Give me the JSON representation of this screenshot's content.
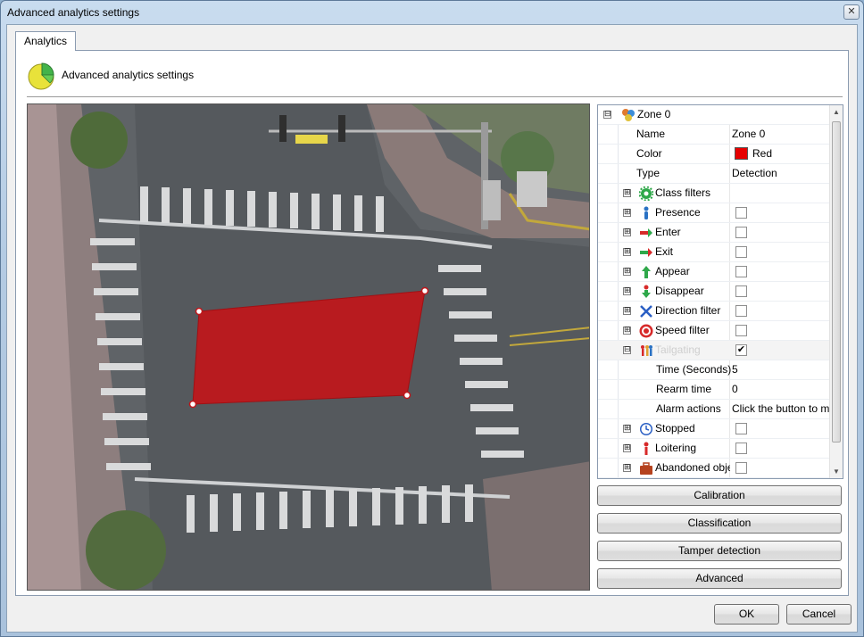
{
  "window": {
    "title": "Advanced analytics settings",
    "close_glyph": "✕"
  },
  "tabs": [
    {
      "label": "Analytics",
      "selected": true
    }
  ],
  "header": {
    "title": "Advanced analytics settings",
    "icon": "pie-chart-icon"
  },
  "zone_polygon": {
    "color": "#c0171b",
    "handle_color": "#ffffff"
  },
  "properties": {
    "zone": {
      "label": "Zone 0",
      "expander": "⊟",
      "icon": "zone-icon"
    },
    "rows": [
      {
        "name": "Name",
        "value": "Zone 0"
      },
      {
        "name": "Color",
        "value": "Red",
        "swatch": "#e60000"
      },
      {
        "name": "Type",
        "value": "Detection"
      },
      {
        "name": "Class filters",
        "icon": "gear-icon"
      },
      {
        "name": "Presence",
        "icon": "person-icon",
        "checked": false
      },
      {
        "name": "Enter",
        "icon": "enter-arrow-icon",
        "checked": false
      },
      {
        "name": "Exit",
        "icon": "exit-arrow-icon",
        "checked": false
      },
      {
        "name": "Appear",
        "icon": "appear-icon",
        "checked": false
      },
      {
        "name": "Disappear",
        "icon": "disappear-icon",
        "checked": false
      },
      {
        "name": "Direction filter",
        "icon": "direction-icon",
        "checked": false
      },
      {
        "name": "Speed filter",
        "icon": "speed-limit-icon",
        "checked": false
      },
      {
        "name": "Tailgating",
        "icon": "tailgating-icon",
        "checked": true
      },
      {
        "name": "Time (Seconds)",
        "value": "5"
      },
      {
        "name": "Rearm time",
        "value": "0"
      },
      {
        "name": "Alarm actions",
        "value": "Click the button to modify"
      },
      {
        "name": "Stopped",
        "icon": "clock-icon",
        "checked": false
      },
      {
        "name": "Loitering",
        "icon": "loitering-icon",
        "checked": false
      },
      {
        "name": "Abandoned object",
        "icon": "luggage-icon",
        "checked": false
      }
    ],
    "expand_glyph": "⊞",
    "collapse_glyph": "⊟",
    "check_glyph": "✔"
  },
  "side_buttons": {
    "calibration": "Calibration",
    "classification": "Classification",
    "tamper": "Tamper detection",
    "advanced": "Advanced"
  },
  "footer": {
    "ok": "OK",
    "cancel": "Cancel"
  }
}
